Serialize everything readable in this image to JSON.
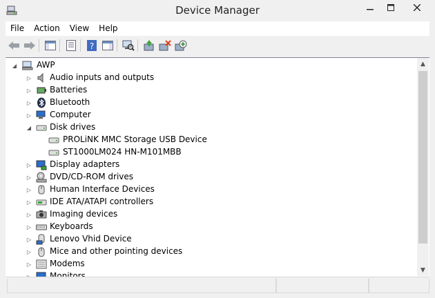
{
  "window": {
    "title": "Device Manager"
  },
  "menu": [
    "File",
    "Action",
    "View",
    "Help"
  ],
  "toolbar": [
    "back-icon",
    "forward-icon",
    "show-hide-console-tree-icon",
    "properties-icon",
    "help-icon",
    "action-pane-icon",
    "scan-hardware-icon",
    "update-driver-icon",
    "uninstall-icon",
    "add-legacy-hardware-icon"
  ],
  "tree": {
    "root": "AWP",
    "nodes": [
      {
        "label": "Audio inputs and outputs",
        "icon": "audio-icon",
        "expanded": false
      },
      {
        "label": "Batteries",
        "icon": "battery-icon",
        "expanded": false
      },
      {
        "label": "Bluetooth",
        "icon": "bluetooth-icon",
        "expanded": false
      },
      {
        "label": "Computer",
        "icon": "computer-icon",
        "expanded": false
      },
      {
        "label": "Disk drives",
        "icon": "disk-drive-icon",
        "expanded": true,
        "children": [
          "PROLiNK MMC Storage USB Device",
          "ST1000LM024 HN-M101MBB"
        ]
      },
      {
        "label": "Display adapters",
        "icon": "display-adapter-icon",
        "expanded": false
      },
      {
        "label": "DVD/CD-ROM drives",
        "icon": "dvd-drive-icon",
        "expanded": false
      },
      {
        "label": "Human Interface Devices",
        "icon": "hid-icon",
        "expanded": false
      },
      {
        "label": "IDE ATA/ATAPI controllers",
        "icon": "ide-controller-icon",
        "expanded": false
      },
      {
        "label": "Imaging devices",
        "icon": "camera-icon",
        "expanded": false
      },
      {
        "label": "Keyboards",
        "icon": "keyboard-icon",
        "expanded": false
      },
      {
        "label": "Lenovo Vhid Device",
        "icon": "lenovo-device-icon",
        "expanded": false
      },
      {
        "label": "Mice and other pointing devices",
        "icon": "mouse-icon",
        "expanded": false
      },
      {
        "label": "Modems",
        "icon": "modem-icon",
        "expanded": false
      },
      {
        "label": "Monitors",
        "icon": "monitor-icon",
        "expanded": false
      }
    ]
  }
}
